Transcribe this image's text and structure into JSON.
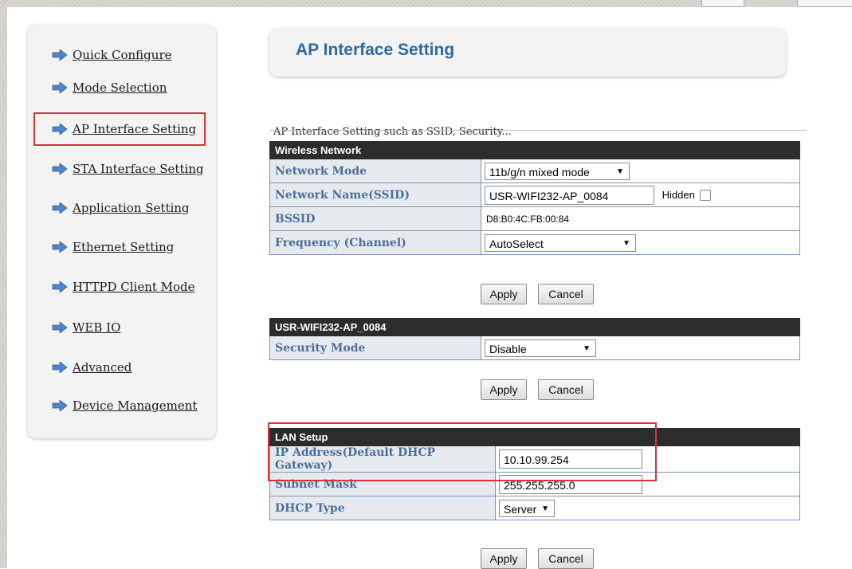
{
  "sidebar": {
    "items": [
      {
        "label": "Quick Configure"
      },
      {
        "label": "Mode Selection"
      },
      {
        "label": "AP Interface Setting"
      },
      {
        "label": "STA Interface Setting"
      },
      {
        "label": "Application Setting"
      },
      {
        "label": "Ethernet Setting"
      },
      {
        "label": "HTTPD Client Mode"
      },
      {
        "label": "WEB IO"
      },
      {
        "label": "Advanced"
      },
      {
        "label": "Device Management"
      }
    ],
    "selected": "AP Interface Setting"
  },
  "main": {
    "title": "AP Interface Setting",
    "description": "AP Interface Setting such as SSID, Security...",
    "wireless": {
      "header": "Wireless Network",
      "network_mode_label": "Network Mode",
      "network_mode_value": "11b/g/n mixed mode",
      "ssid_label": "Network Name(SSID)",
      "ssid_value": "USR-WIFI232-AP_0084",
      "hidden_label": "Hidden",
      "bssid_label": "BSSID",
      "bssid_value": "D8:B0:4C:FB:00:84",
      "frequency_label": "Frequency (Channel)",
      "frequency_value": "AutoSelect"
    },
    "security": {
      "header": "USR-WIFI232-AP_0084",
      "mode_label": "Security Mode",
      "mode_value": "Disable"
    },
    "lan": {
      "header": "LAN Setup",
      "ip_label": "IP Address(Default DHCP Gateway)",
      "ip_value": "10.10.99.254",
      "subnet_label": "Subnet Mask",
      "subnet_value": "255.255.255.0",
      "dhcp_label": "DHCP Type",
      "dhcp_value": "Server"
    },
    "buttons": {
      "apply": "Apply",
      "cancel": "Cancel"
    }
  },
  "colors": {
    "title": "#2d6a9f",
    "label": "#4a6f9a",
    "highlight": "#d9323a",
    "arrow": "#4f86c6"
  },
  "icons": {
    "nav": "arrow-right-icon",
    "dropdown": "caret-down-icon"
  }
}
